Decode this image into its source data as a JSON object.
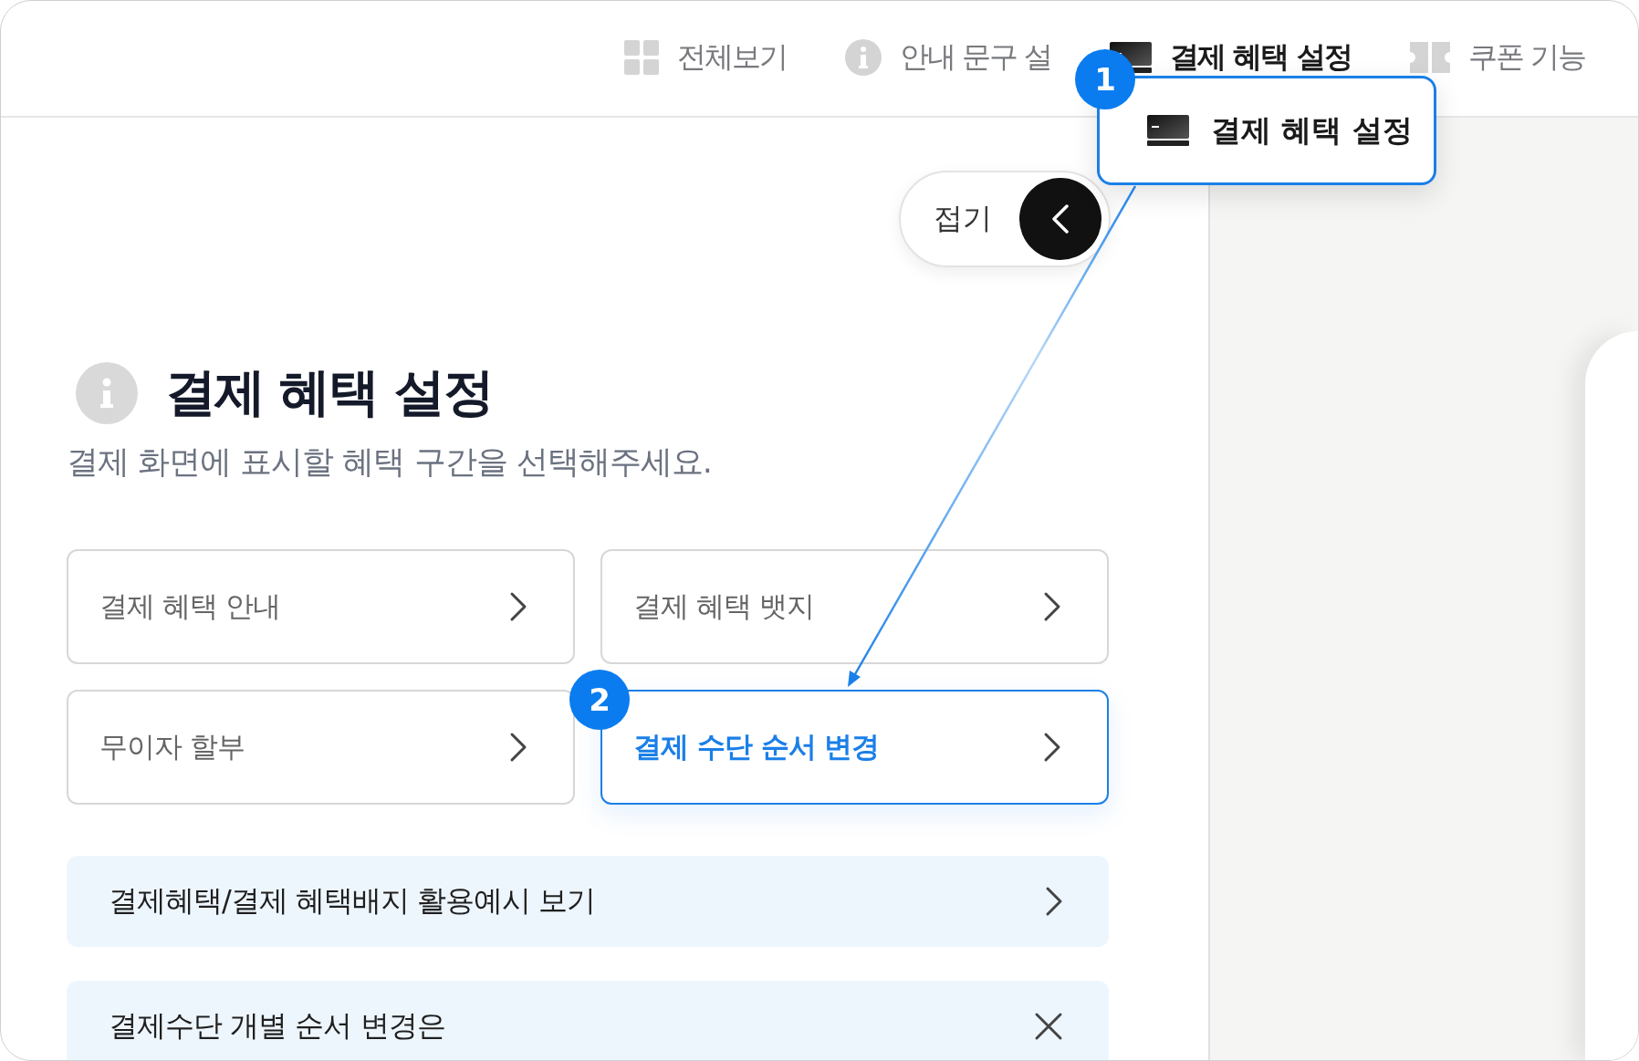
{
  "nav": {
    "items": [
      {
        "label": "전체보기",
        "kind": "grid",
        "selected": false
      },
      {
        "label": "안내 문구 설",
        "kind": "info",
        "selected": false
      },
      {
        "label": "결제 혜택 설정",
        "kind": "card",
        "selected": true
      },
      {
        "label": "쿠폰 기능",
        "kind": "ticket",
        "selected": false
      }
    ]
  },
  "collapse_button": {
    "label": "접기"
  },
  "header": {
    "title": "결제 혜택 설정",
    "subtitle": "결제 화면에 표시할 혜택 구간을 선택해주세요."
  },
  "options": [
    {
      "label": "결제 혜택 안내",
      "selected": false
    },
    {
      "label": "결제 혜택 뱃지",
      "selected": false
    },
    {
      "label": "무이자 할부",
      "selected": false
    },
    {
      "label": "결제 수단 순서 변경",
      "selected": true
    }
  ],
  "banners": [
    {
      "label": "결제혜택/결제 혜택배지 활용예시 보기",
      "kind": "link"
    },
    {
      "label": "결제수단 개별 순서 변경은",
      "kind": "dismiss"
    }
  ],
  "callouts": [
    {
      "number": "1",
      "label": "결제 혜택 설정"
    },
    {
      "number": "2"
    }
  ]
}
